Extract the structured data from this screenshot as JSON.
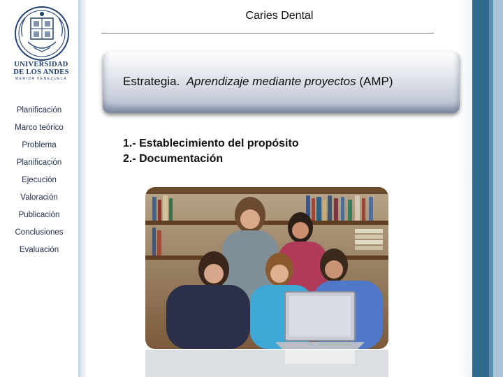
{
  "header": {
    "title": "Caries Dental"
  },
  "logo": {
    "line1": "UNIVERSIDAD",
    "line2": "DE LOS ANDES",
    "line3": "MÉRIDA VENEZUELA"
  },
  "sidebar": {
    "items": [
      {
        "label": "Planificación"
      },
      {
        "label": "Marco teórico"
      },
      {
        "label": "Problema"
      },
      {
        "label": "Planificación"
      },
      {
        "label": "Ejecución"
      },
      {
        "label": "Valoración"
      },
      {
        "label": "Publicación"
      },
      {
        "label": "Conclusiones"
      },
      {
        "label": "Evaluación"
      }
    ]
  },
  "strategy": {
    "prefix": "Estrategia.",
    "italic": "Aprendizaje mediante proyectos",
    "suffix": "(AMP)"
  },
  "steps": [
    "1.- Establecimiento del propósito",
    "2.- Documentación"
  ],
  "photo": {
    "icon": "students-laptop-photo"
  },
  "colors": {
    "accent_dark": "#2f6a8c",
    "accent_light": "#a9c4d8",
    "nav_text": "#1b2a4a"
  }
}
